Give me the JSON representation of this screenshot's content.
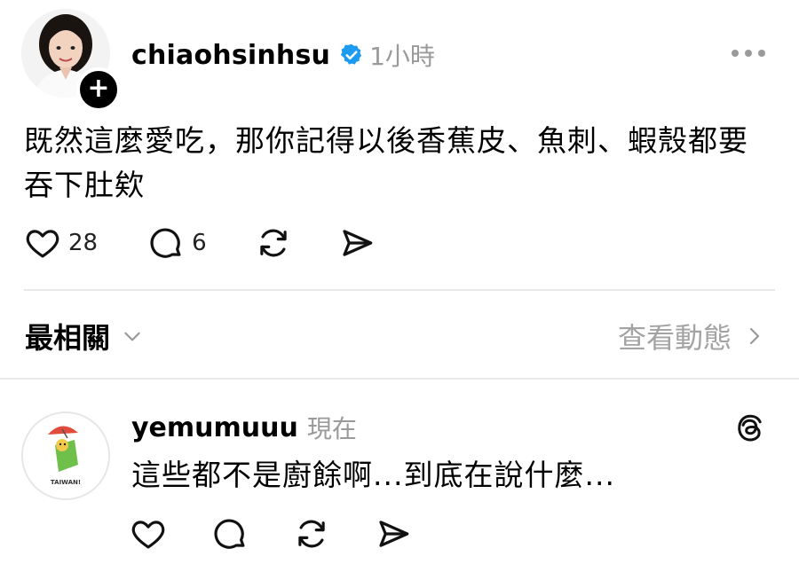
{
  "post": {
    "username": "chiaohsinhsu",
    "time": "1小時",
    "text": "既然這麼愛吃，那你記得以後香蕉皮、魚刺、蝦殼都要吞下肚欸",
    "like_count": "28",
    "reply_count": "6",
    "follow_symbol": "+",
    "verified_color": "#1d9bf0"
  },
  "filter": {
    "label": "最相關",
    "activity_label": "查看動態"
  },
  "reply": {
    "username": "yemumuuu",
    "time": "現在",
    "text": "這些都不是廚餘啊...到底在說什麼...",
    "avatar_text": "TAIWAN!"
  },
  "icons": {
    "like": "heart-icon",
    "reply": "comment-icon",
    "repost": "repost-icon",
    "share": "send-icon",
    "more": "more-icon",
    "threads": "threads-logo-icon"
  }
}
